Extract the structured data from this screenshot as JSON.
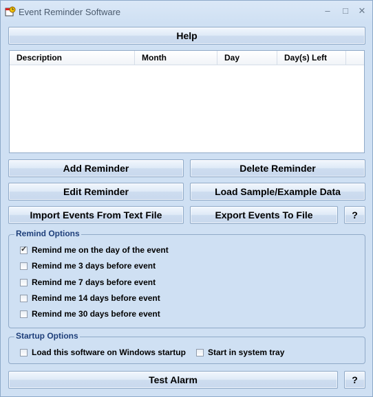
{
  "window": {
    "title": "Event Reminder Software",
    "controls": [
      "–",
      "□",
      "✕"
    ]
  },
  "buttons": {
    "help": "Help",
    "add": "Add Reminder",
    "delete": "Delete Reminder",
    "edit": "Edit Reminder",
    "load_sample": "Load Sample/Example Data",
    "import": "Import Events From Text File",
    "export": "Export Events To File",
    "export_help": "?",
    "test_alarm": "Test Alarm",
    "test_help": "?"
  },
  "list": {
    "columns": [
      "Description",
      "Month",
      "Day",
      "Day(s) Left"
    ],
    "rows": []
  },
  "remind_options": {
    "title": "Remind Options",
    "items": [
      {
        "label": "Remind me on the day of the event",
        "checked": true
      },
      {
        "label": "Remind me 3 days before event",
        "checked": false
      },
      {
        "label": "Remind me 7 days before event",
        "checked": false
      },
      {
        "label": "Remind me 14 days before event",
        "checked": false
      },
      {
        "label": "Remind me 30 days before event",
        "checked": false
      }
    ]
  },
  "startup_options": {
    "title": "Startup Options",
    "items": [
      {
        "label": "Load this software on Windows startup",
        "checked": false
      },
      {
        "label": "Start in system tray",
        "checked": false
      }
    ]
  },
  "icons": {
    "app": "calendar-clock-icon"
  }
}
